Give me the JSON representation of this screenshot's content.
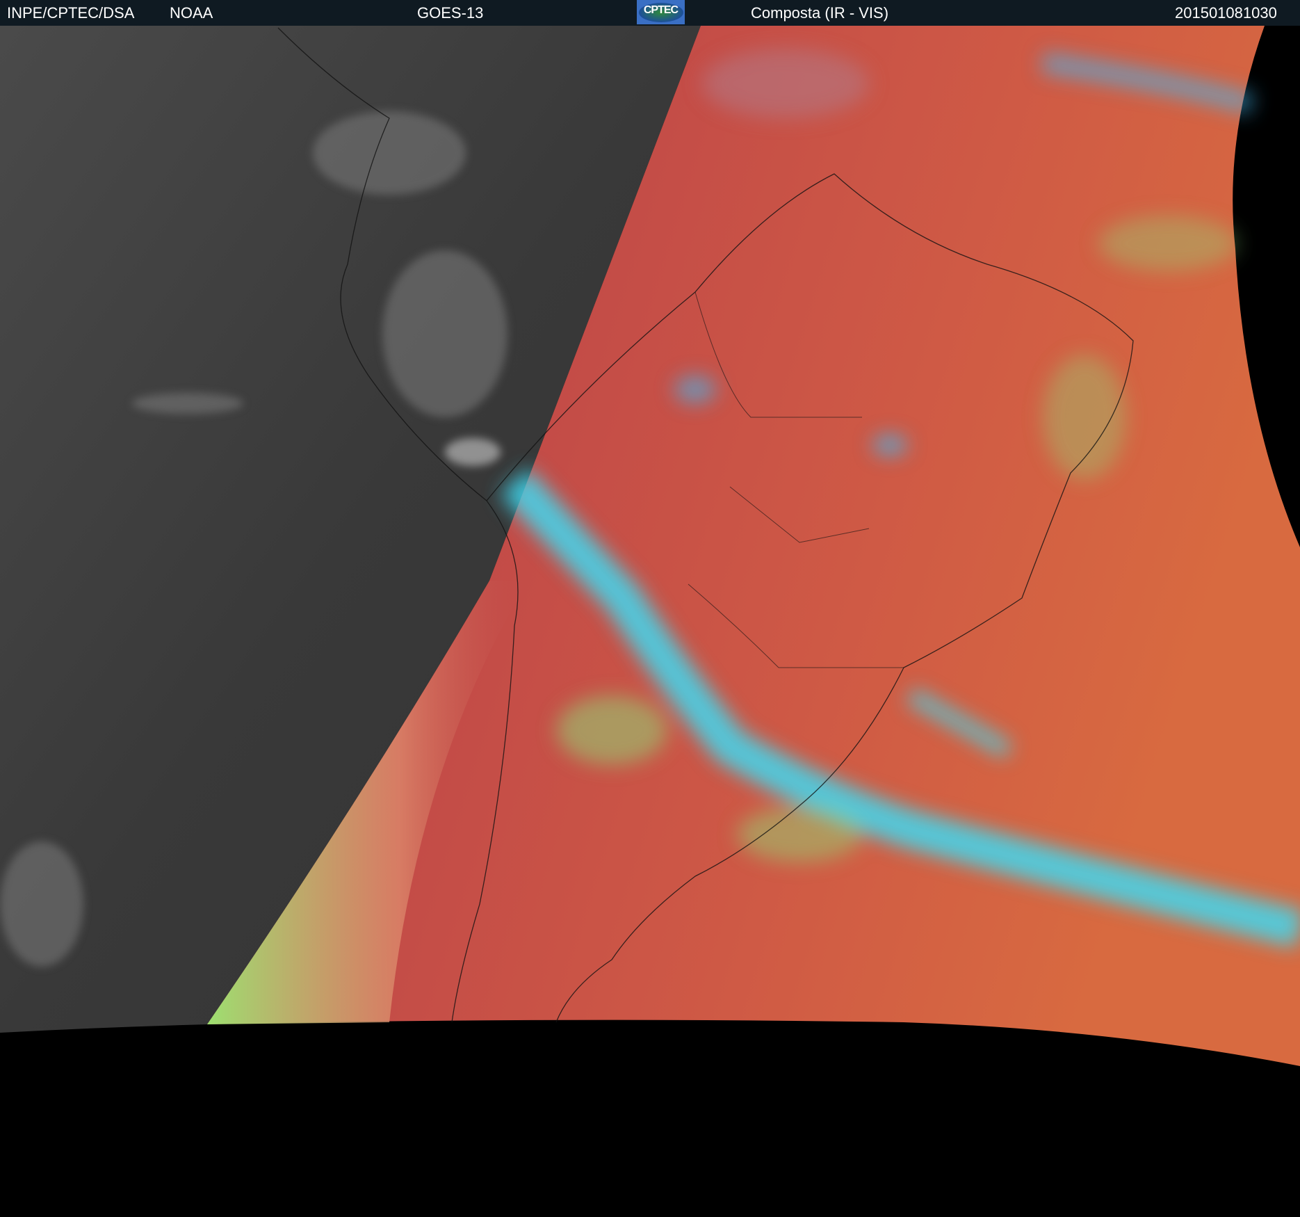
{
  "header": {
    "agency": "INPE/CPTEC/DSA",
    "source": "NOAA",
    "satellite": "GOES-13",
    "logo_text": "CPTEC",
    "product": "Composta (IR - VIS)",
    "timestamp": "201501081030"
  },
  "colors": {
    "header_bg": "#0f1a22",
    "night_gray": "#3c3c3c",
    "land_red": "#c24a4a",
    "cloud_cyan": "#3fd8f0",
    "cloud_green": "#8ee07a",
    "ocean_orange": "#d8653f"
  }
}
